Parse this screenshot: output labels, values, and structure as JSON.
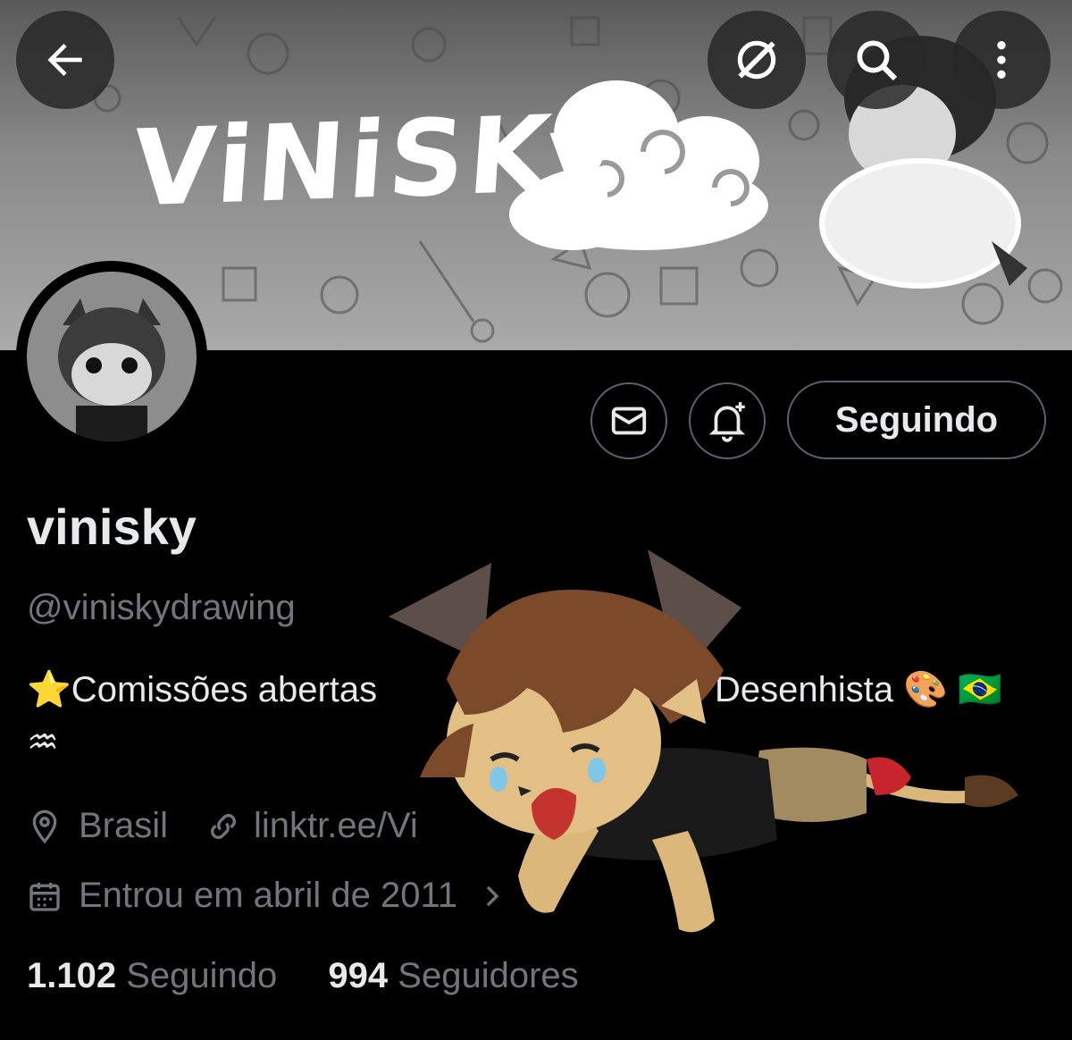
{
  "banner": {
    "title": "ViNiSKy"
  },
  "header": {
    "back_icon": "arrow-left-icon",
    "grok_icon": "grok-slash-icon",
    "search_icon": "search-icon",
    "more_icon": "more-vertical-icon"
  },
  "profile": {
    "display_name": "vinisky",
    "handle": "@viniskydrawing",
    "bio_line1": "⭐Comissões abertas",
    "bio_line1_end": "Desenhista 🎨 🇧🇷",
    "bio_line2": "♒",
    "location": "Brasil",
    "link": "linktr.ee/Vi",
    "joined": "Entrou em abril de 2011",
    "following_count": "1.102",
    "following_label": "Seguindo",
    "followers_count": "994",
    "followers_label": "Seguidores"
  },
  "actions": {
    "follow_label": "Seguindo",
    "message_icon": "envelope-icon",
    "notify_icon": "bell-plus-icon"
  },
  "colors": {
    "background": "#000000",
    "primary_text": "#e7e9ea",
    "secondary_text": "#71767b",
    "border": "#536471"
  }
}
